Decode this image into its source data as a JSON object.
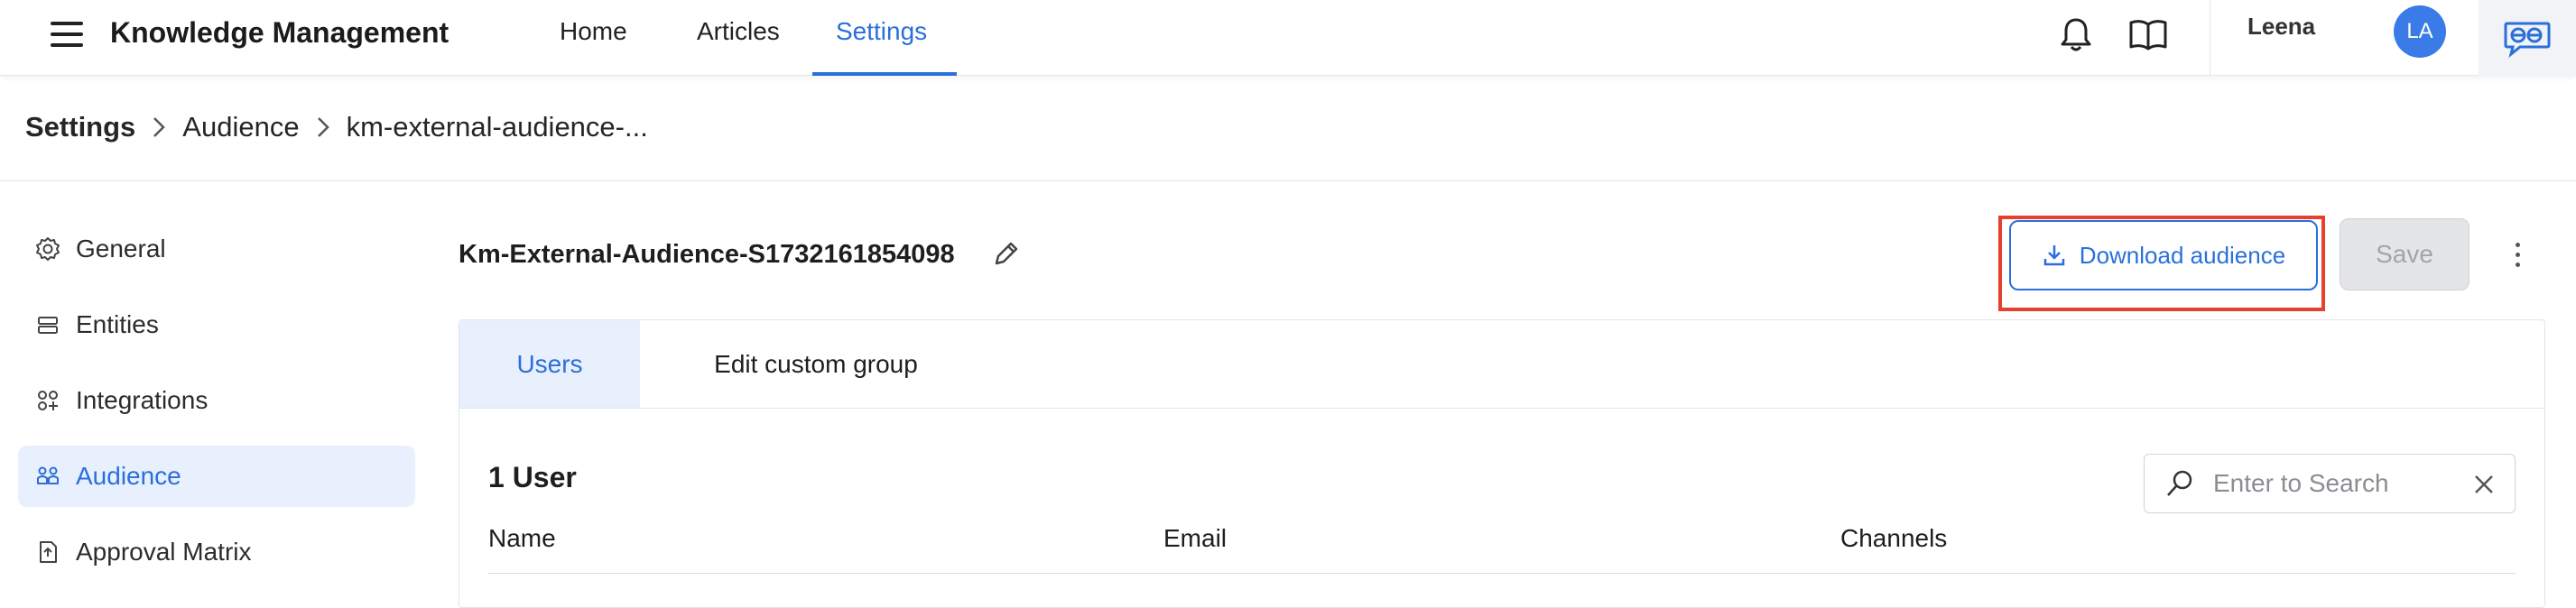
{
  "topbar": {
    "title": "Knowledge Management",
    "nav": [
      {
        "label": "Home",
        "active": false
      },
      {
        "label": "Articles",
        "active": false
      },
      {
        "label": "Settings",
        "active": true
      }
    ],
    "icons": [
      "menu-icon",
      "bell-icon",
      "book-icon",
      "brand-logo-icon"
    ],
    "user_name": "Leena",
    "avatar_initials": "LA"
  },
  "breadcrumb": [
    "Settings",
    "Audience",
    "km-external-audience-..."
  ],
  "sidebar": {
    "items": [
      {
        "label": "General",
        "icon": "gear-icon",
        "active": false
      },
      {
        "label": "Entities",
        "icon": "list-icon",
        "active": false
      },
      {
        "label": "Integrations",
        "icon": "integrations-icon",
        "active": false
      },
      {
        "label": "Audience",
        "icon": "audience-icon",
        "active": true
      },
      {
        "label": "Approval Matrix",
        "icon": "approval-icon",
        "active": false
      }
    ]
  },
  "main": {
    "audience_name": "Km-External-Audience-S1732161854098",
    "download_label": "Download audience",
    "save_label": "Save",
    "tabs": [
      {
        "label": "Users",
        "active": true
      },
      {
        "label": "Edit custom group",
        "active": false
      }
    ],
    "user_count": "1 User",
    "search_placeholder": "Enter to Search",
    "columns": [
      "Name",
      "Email",
      "Channels"
    ]
  },
  "colors": {
    "accent": "#2a6fdb",
    "active_bg": "#e8effd",
    "highlight_border": "#e5412e"
  }
}
